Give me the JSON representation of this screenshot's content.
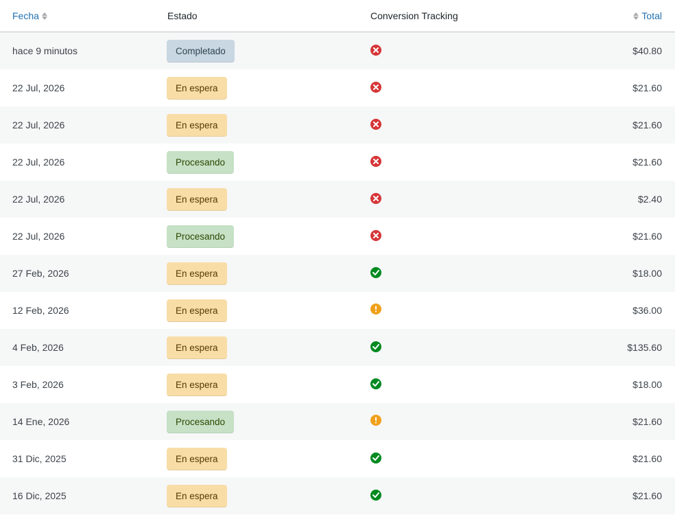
{
  "header": {
    "fecha": "Fecha",
    "estado": "Estado",
    "conversion": "Conversion Tracking",
    "total": "Total"
  },
  "colors": {
    "link": "#2271b1",
    "fail": "#d63638",
    "success": "#008a20",
    "warning": "#f0a01a"
  },
  "rows": [
    {
      "fecha": "hace 9 minutos",
      "estado": "Completado",
      "estado_type": "completado",
      "tracking": "x-circle-icon",
      "total": "$40.80"
    },
    {
      "fecha": "22 Jul, 2026",
      "estado": "En espera",
      "estado_type": "espera",
      "tracking": "x-circle-icon",
      "total": "$21.60"
    },
    {
      "fecha": "22 Jul, 2026",
      "estado": "En espera",
      "estado_type": "espera",
      "tracking": "x-circle-icon",
      "total": "$21.60"
    },
    {
      "fecha": "22 Jul, 2026",
      "estado": "Procesando",
      "estado_type": "procesando",
      "tracking": "x-circle-icon",
      "total": "$21.60"
    },
    {
      "fecha": "22 Jul, 2026",
      "estado": "En espera",
      "estado_type": "espera",
      "tracking": "x-circle-icon",
      "total": "$2.40"
    },
    {
      "fecha": "22 Jul, 2026",
      "estado": "Procesando",
      "estado_type": "procesando",
      "tracking": "x-circle-icon",
      "total": "$21.60"
    },
    {
      "fecha": "27 Feb, 2026",
      "estado": "En espera",
      "estado_type": "espera",
      "tracking": "check-circle-icon",
      "total": "$18.00"
    },
    {
      "fecha": "12 Feb, 2026",
      "estado": "En espera",
      "estado_type": "espera",
      "tracking": "warning-circle-icon",
      "total": "$36.00"
    },
    {
      "fecha": "4 Feb, 2026",
      "estado": "En espera",
      "estado_type": "espera",
      "tracking": "check-circle-icon",
      "total": "$135.60"
    },
    {
      "fecha": "3 Feb, 2026",
      "estado": "En espera",
      "estado_type": "espera",
      "tracking": "check-circle-icon",
      "total": "$18.00"
    },
    {
      "fecha": "14 Ene, 2026",
      "estado": "Procesando",
      "estado_type": "procesando",
      "tracking": "warning-circle-icon",
      "total": "$21.60"
    },
    {
      "fecha": "31 Dic, 2025",
      "estado": "En espera",
      "estado_type": "espera",
      "tracking": "check-circle-icon",
      "total": "$21.60"
    },
    {
      "fecha": "16 Dic, 2025",
      "estado": "En espera",
      "estado_type": "espera",
      "tracking": "check-circle-icon",
      "total": "$21.60"
    }
  ]
}
